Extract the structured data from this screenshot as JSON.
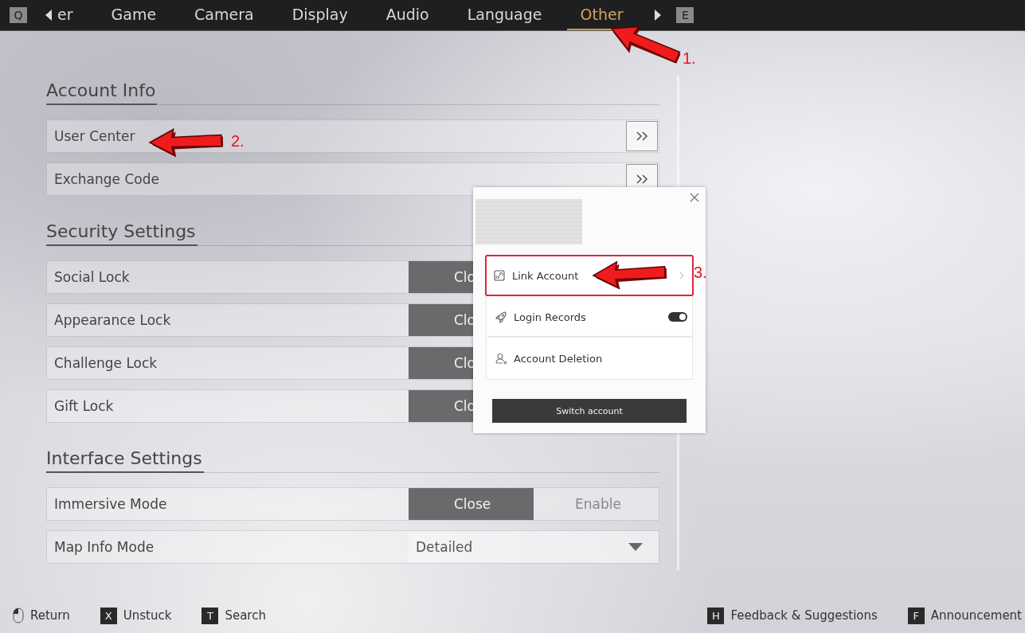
{
  "tabs": {
    "prev_key": "Q",
    "next_key": "E",
    "items": [
      {
        "label": "er",
        "selected": false
      },
      {
        "label": "Game",
        "selected": false
      },
      {
        "label": "Camera",
        "selected": false
      },
      {
        "label": "Display",
        "selected": false
      },
      {
        "label": "Audio",
        "selected": false
      },
      {
        "label": "Language",
        "selected": false
      },
      {
        "label": "Other",
        "selected": true
      }
    ]
  },
  "sections": [
    {
      "title": "Account Info",
      "rows": [
        {
          "label": "User Center",
          "kind": "link"
        },
        {
          "label": "Exchange Code",
          "kind": "link"
        }
      ]
    },
    {
      "title": "Security Settings",
      "rows": [
        {
          "label": "Social Lock",
          "kind": "toggle",
          "options": [
            {
              "label": "Clo",
              "selected": true
            }
          ]
        },
        {
          "label": "Appearance Lock",
          "kind": "toggle",
          "options": [
            {
              "label": "Clo",
              "selected": true
            }
          ]
        },
        {
          "label": "Challenge Lock",
          "kind": "toggle",
          "options": [
            {
              "label": "Clo",
              "selected": true
            }
          ]
        },
        {
          "label": "Gift Lock",
          "kind": "toggle",
          "options": [
            {
              "label": "Clo",
              "selected": true
            }
          ]
        }
      ]
    },
    {
      "title": "Interface Settings",
      "rows": [
        {
          "label": "Immersive Mode",
          "kind": "toggle",
          "options": [
            {
              "label": "Close",
              "selected": true
            },
            {
              "label": "Enable",
              "selected": false
            }
          ]
        },
        {
          "label": "Map Info Mode",
          "kind": "dropdown",
          "value": "Detailed"
        }
      ]
    }
  ],
  "popup": {
    "items": [
      {
        "label": "Link Account",
        "kind": "link",
        "highlighted": true
      },
      {
        "label": "Login Records",
        "kind": "switch",
        "on": true,
        "highlighted": false
      },
      {
        "label": "Account Deletion",
        "kind": "plain",
        "highlighted": false
      }
    ],
    "button": "Switch account"
  },
  "annotations": [
    {
      "label": "1."
    },
    {
      "label": "2."
    },
    {
      "label": "3."
    }
  ],
  "footer": {
    "left": [
      {
        "kind": "mouse",
        "label": "Return"
      },
      {
        "kind": "key",
        "key": "X",
        "label": "Unstuck"
      },
      {
        "kind": "key",
        "key": "T",
        "label": "Search"
      }
    ],
    "right": [
      {
        "kind": "key",
        "key": "H",
        "label": "Feedback & Suggestions"
      },
      {
        "kind": "key",
        "key": "F",
        "label": "Announcement"
      }
    ]
  }
}
